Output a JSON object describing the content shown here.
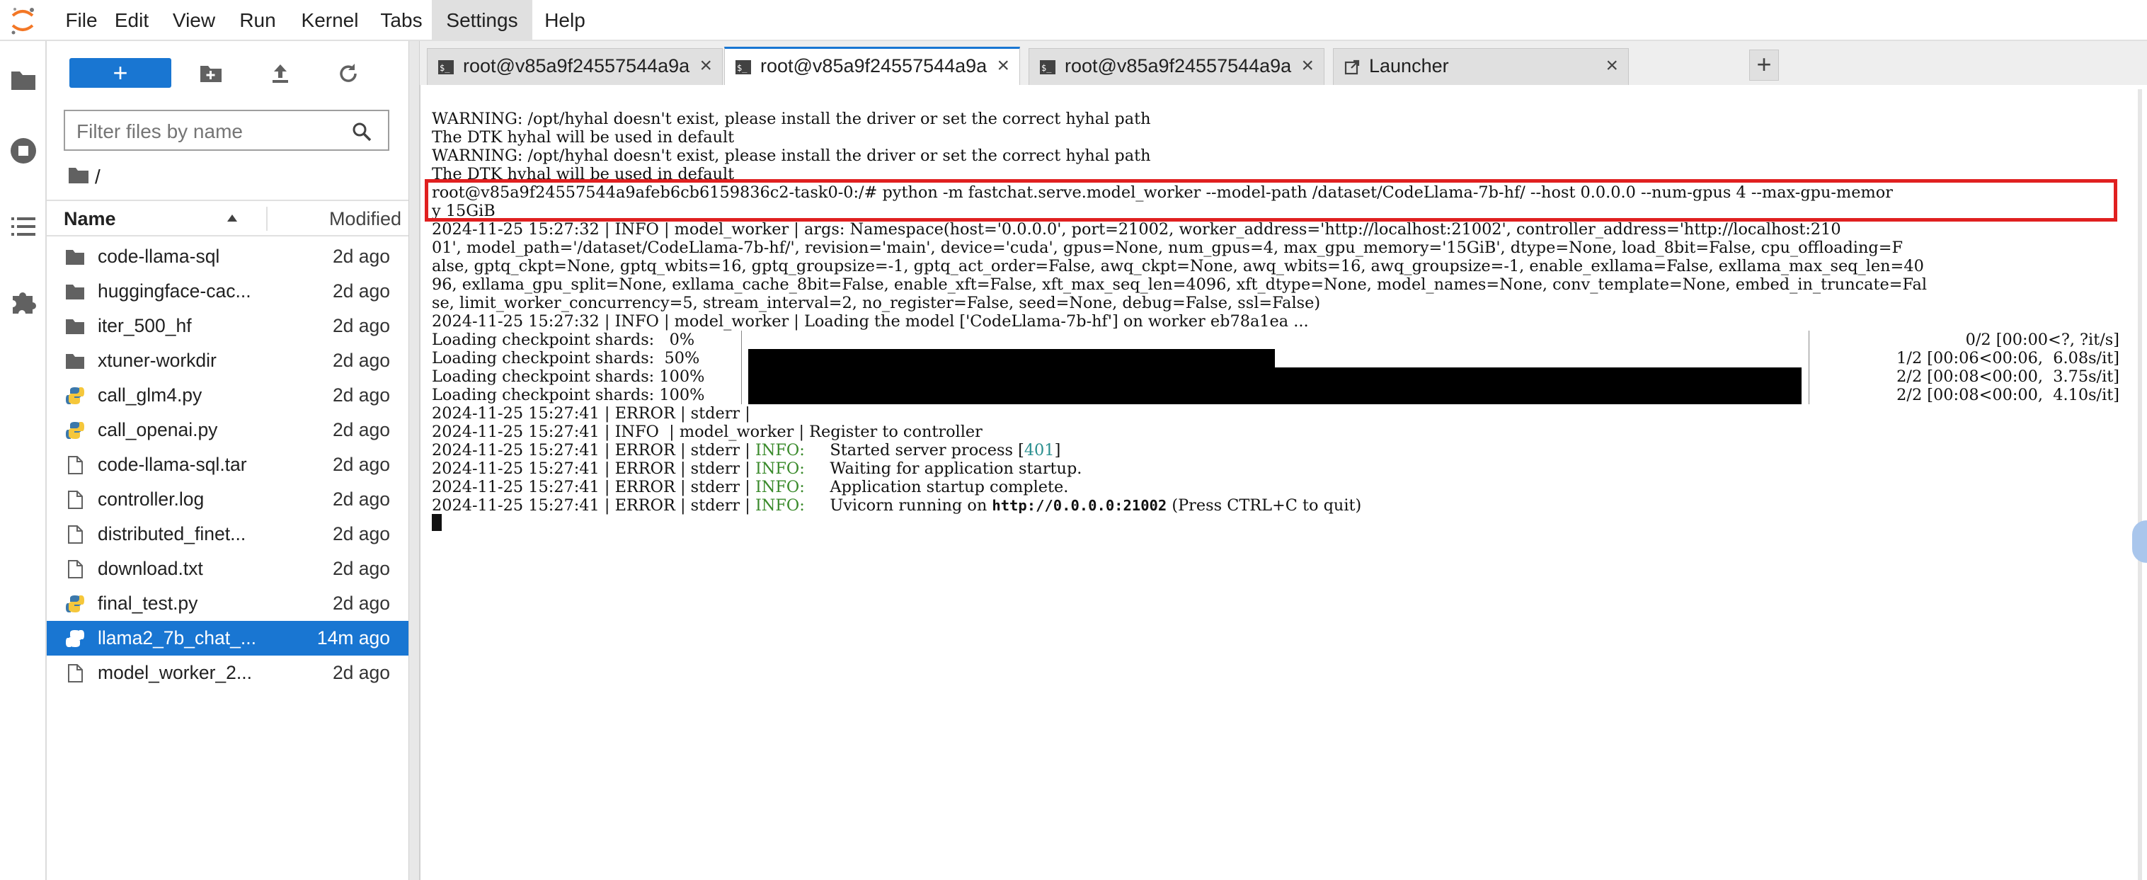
{
  "menubar": {
    "items": [
      {
        "label": "File"
      },
      {
        "label": "Edit"
      },
      {
        "label": "View"
      },
      {
        "label": "Run"
      },
      {
        "label": "Kernel"
      },
      {
        "label": "Tabs"
      },
      {
        "label": "Settings"
      },
      {
        "label": "Help"
      }
    ],
    "active_item": "Settings"
  },
  "activity_bar": {
    "icons": [
      "folder-icon",
      "running-icon",
      "table-of-contents-icon",
      "extension-icon"
    ]
  },
  "file_browser": {
    "new_button_label": "+",
    "filter_placeholder": "Filter files by name",
    "breadcrumb": "/",
    "columns": {
      "name": "Name",
      "modified": "Modified"
    },
    "files": [
      {
        "name": "code-llama-sql",
        "modified": "2d ago",
        "type": "folder"
      },
      {
        "name": "huggingface-cac...",
        "modified": "2d ago",
        "type": "folder"
      },
      {
        "name": "iter_500_hf",
        "modified": "2d ago",
        "type": "folder"
      },
      {
        "name": "xtuner-workdir",
        "modified": "2d ago",
        "type": "folder"
      },
      {
        "name": "call_glm4.py",
        "modified": "2d ago",
        "type": "python"
      },
      {
        "name": "call_openai.py",
        "modified": "2d ago",
        "type": "python"
      },
      {
        "name": "code-llama-sql.tar",
        "modified": "2d ago",
        "type": "file"
      },
      {
        "name": "controller.log",
        "modified": "2d ago",
        "type": "file"
      },
      {
        "name": "distributed_finet...",
        "modified": "2d ago",
        "type": "file"
      },
      {
        "name": "download.txt",
        "modified": "2d ago",
        "type": "file"
      },
      {
        "name": "final_test.py",
        "modified": "2d ago",
        "type": "python"
      },
      {
        "name": "llama2_7b_chat_...",
        "modified": "14m ago",
        "type": "python",
        "selected": true
      },
      {
        "name": "model_worker_2...",
        "modified": "2d ago",
        "type": "file"
      }
    ]
  },
  "tabs": [
    {
      "label": "root@v85a9f24557544a9a",
      "close": "×",
      "type": "terminal"
    },
    {
      "label": "root@v85a9f24557544a9a",
      "close": "×",
      "type": "terminal",
      "active": true
    },
    {
      "label": "root@v85a9f24557544a9a",
      "close": "×",
      "type": "terminal"
    },
    {
      "label": "Launcher",
      "close": "×",
      "type": "launcher"
    }
  ],
  "add_tab_label": "+",
  "terminal": {
    "lines": [
      "WARNING: /opt/hyhal doesn't exist, please install the driver or set the correct hyhal path",
      "The DTK hyhal will be used in default",
      "WARNING: /opt/hyhal doesn't exist, please install the driver or set the correct hyhal path",
      "The DTK hyhal will be used in default",
      "root@v85a9f24557544a9afeb6cb6159836c2-task0-0:/# python -m fastchat.serve.model_worker --model-path /dataset/CodeLlama-7b-hf/ --host 0.0.0.0 --num-gpus 4 --max-gpu-memor",
      "y 15GiB",
      "2024-11-25 15:27:32 | INFO | model_worker | args: Namespace(host='0.0.0.0', port=21002, worker_address='http://localhost:21002', controller_address='http://localhost:210",
      "01', model_path='/dataset/CodeLlama-7b-hf/', revision='main', device='cuda', gpus=None, num_gpus=4, max_gpu_memory='15GiB', dtype=None, load_8bit=False, cpu_offloading=F",
      "alse, gptq_ckpt=None, gptq_wbits=16, gptq_groupsize=-1, gptq_act_order=False, awq_ckpt=None, awq_wbits=16, awq_groupsize=-1, enable_exllama=False, exllama_max_seq_len=40",
      "96, exllama_gpu_split=None, exllama_cache_8bit=False, enable_xft=False, xft_max_seq_len=4096, xft_dtype=None, model_names=None, conv_template=None, embed_in_truncate=Fal",
      "se, limit_worker_concurrency=5, stream_interval=2, no_register=False, seed=None, debug=False, ssl=False)",
      "2024-11-25 15:27:32 | INFO | model_worker | Loading the model ['CodeLlama-7b-hf'] on worker eb78a1ea ..."
    ],
    "progress": [
      {
        "label": "Loading checkpoint shards:   0%",
        "stats": "0/2 [00:00<?, ?it/s]",
        "fraction": 0.0
      },
      {
        "label": "Loading checkpoint shards:  50%",
        "stats": "1/2 [00:06<00:06,  6.08s/it]",
        "fraction": 0.5
      },
      {
        "label": "Loading checkpoint shards: 100%",
        "stats": "2/2 [00:08<00:00,  3.75s/it]",
        "fraction": 1.0
      },
      {
        "label": "Loading checkpoint shards: 100%",
        "stats": "2/2 [00:08<00:00,  4.10s/it]",
        "fraction": 1.0
      }
    ],
    "log": [
      {
        "ts": "2024-11-25 15:27:41",
        "level": "ERROR",
        "src": "stderr",
        "tag": "",
        "msg": ""
      },
      {
        "ts": "2024-11-25 15:27:41",
        "level": "INFO",
        "src": "model_worker",
        "tag": "",
        "msg": "Register to controller"
      },
      {
        "ts": "2024-11-25 15:27:41",
        "level": "ERROR",
        "src": "stderr",
        "tag": "INFO:",
        "msg": "Started server process [",
        "pid": "401",
        "tail": "]"
      },
      {
        "ts": "2024-11-25 15:27:41",
        "level": "ERROR",
        "src": "stderr",
        "tag": "INFO:",
        "msg": "Waiting for application startup."
      },
      {
        "ts": "2024-11-25 15:27:41",
        "level": "ERROR",
        "src": "stderr",
        "tag": "INFO:",
        "msg": "Application startup complete."
      },
      {
        "ts": "2024-11-25 15:27:41",
        "level": "ERROR",
        "src": "stderr",
        "tag": "INFO:",
        "msg": "Uvicorn running on ",
        "url": "http://0.0.0.0:21002",
        "tail": " (Press CTRL+C to quit)"
      }
    ],
    "sep": "|"
  },
  "colors": {
    "accent": "#1976d2",
    "highlight_box": "#e02020",
    "log_info_tag": "#3a8a2b",
    "pid": "#2a8f8f"
  }
}
